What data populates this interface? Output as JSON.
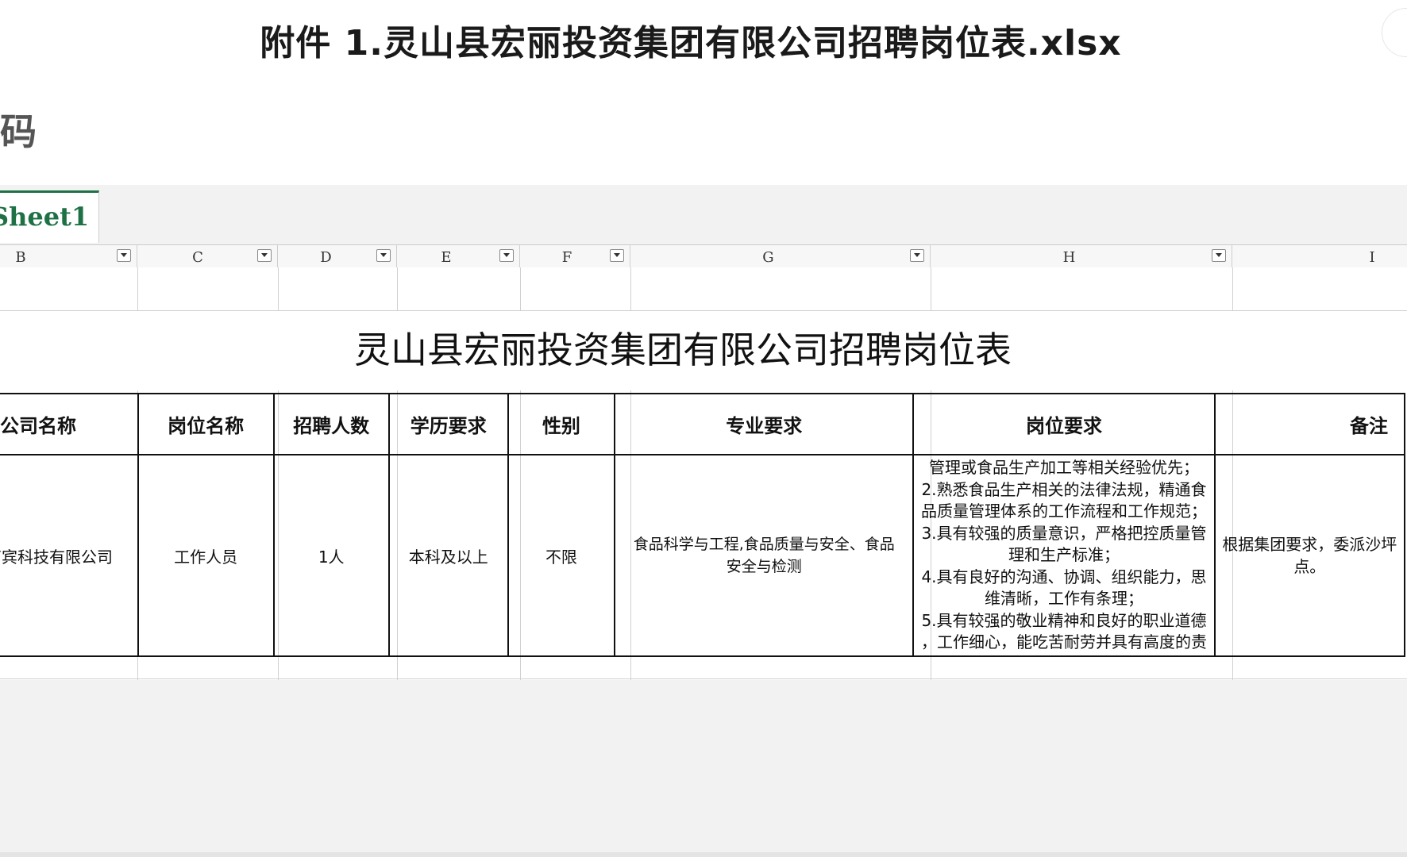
{
  "file_title": "附件 1.灵山县宏丽投资集团有限公司招聘岗位表.xlsx",
  "side_char": "码",
  "sheet_tab": "Sheet1",
  "columns": [
    "B",
    "C",
    "D",
    "E",
    "F",
    "G",
    "H",
    "I"
  ],
  "sheet_title": "灵山县宏丽投资集团有限公司招聘岗位表",
  "table": {
    "headers": [
      "公司名称",
      "岗位名称",
      "招聘人数",
      "学历要求",
      "性别",
      "专业要求",
      "岗位要求",
      "备注"
    ],
    "row": {
      "company": "南宾科技有限公司",
      "position": "工作人员",
      "count": "1人",
      "education": "本科及以上",
      "gender": "不限",
      "major_line1": "食品科学与工程,食品质量与安全、食品",
      "major_line2": "安全与检测",
      "requirements": [
        "管理或食品生产加工等相关经验优先；",
        "2.熟悉食品生产相关的法律法规，精通食",
        "品质量管理体系的工作流程和工作规范；",
        "3.具有较强的质量意识，严格把控质量管",
        "理和生产标准；",
        "4.具有良好的沟通、协调、组织能力，思",
        "维清晰，工作有条理；",
        "5.具有较强的敬业精神和良好的职业道德",
        "，工作细心，能吃苦耐劳并具有高度的责"
      ],
      "note_line1": "根据集团要求，委派沙坪",
      "note_line2": "点。"
    }
  }
}
